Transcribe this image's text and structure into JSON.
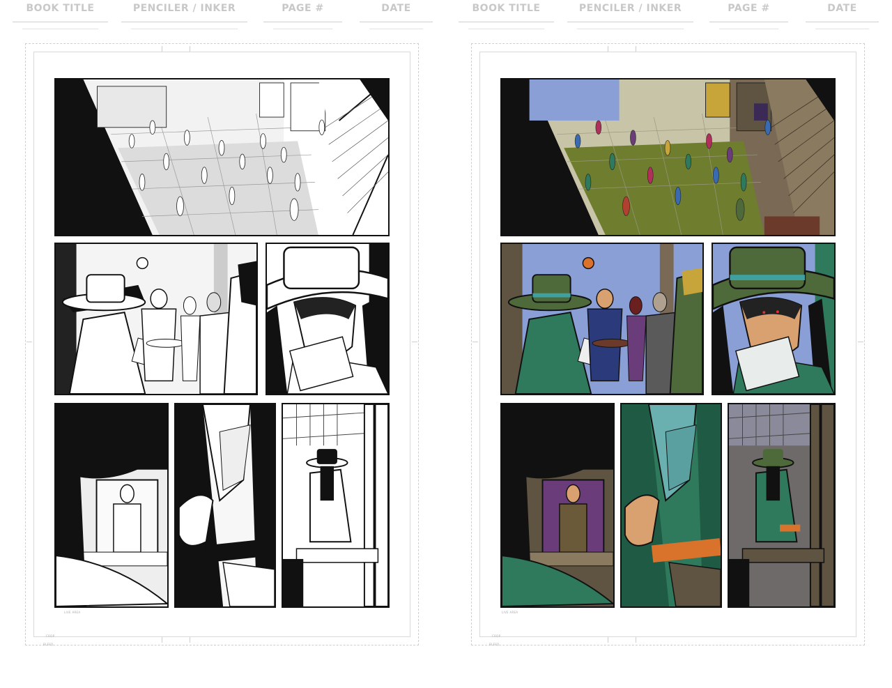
{
  "header": {
    "book_title": "BOOK TITLE",
    "penciler_inker": "PENCILER / INKER",
    "page_number": "PAGE #",
    "date": "DATE"
  },
  "guides": {
    "live_area": "LIVE AREA",
    "crop": "CROP",
    "bleed": "BLEED"
  },
  "pages": [
    {
      "id": "inks",
      "style": "black-and-white"
    },
    {
      "id": "colors",
      "style": "full-color"
    }
  ],
  "colors": {
    "header_text": "#c8c8c8",
    "ink": "#111111",
    "sky_blue": "#8a9fd6",
    "coat_green": "#2f7a5c",
    "hat_green": "#4f6a3a",
    "floor_olive": "#6f7d2e",
    "wall_brown": "#7a6a55",
    "purple_wall": "#6a3d7a",
    "orange_moon": "#d9732c"
  }
}
